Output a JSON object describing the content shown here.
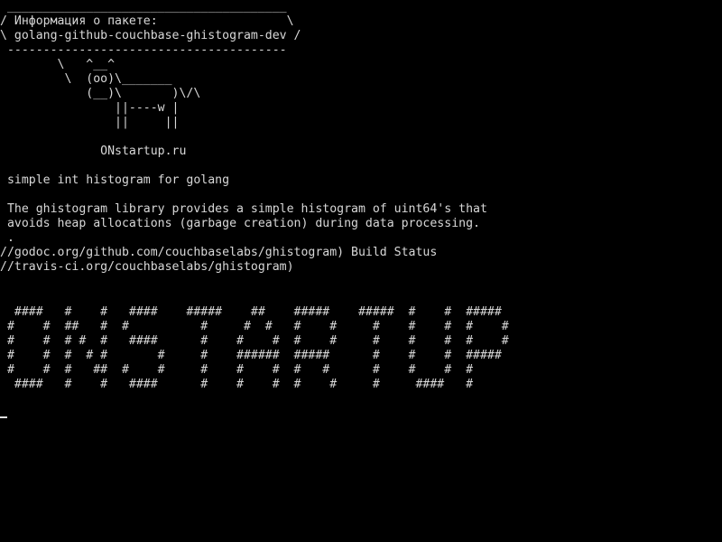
{
  "terminal": {
    "foreground": "#d8d8d8",
    "background": "#000000",
    "lines": [
      " _______________________________________",
      "/ Информация о пакете:                  \\",
      "\\ golang-github-couchbase-ghistogram-dev /",
      " ---------------------------------------",
      "        \\   ^__^",
      "         \\  (oo)\\_______",
      "            (__)\\       )\\/\\",
      "                ||----w |",
      "                ||     ||",
      "",
      "              ONstartup.ru",
      "",
      " simple int histogram for golang",
      "",
      " The ghistogram library provides a simple histogram of uint64's that",
      " avoids heap allocations (garbage creation) during data processing.",
      " .",
      "//godoc.org/github.com/couchbaselabs/ghistogram) Build Status",
      "//travis-ci.org/couchbaselabs/ghistogram)",
      "",
      "",
      "  ####   #    #   ####    #####    ##    #####    #####  #    #  #####",
      " #    #  ##   #  #          #     #  #   #    #     #    #    #  #    #",
      " #    #  # #  #   ####      #    #    #  #    #     #    #    #  #    #",
      " #    #  #  # #       #     #    ######  #####      #    #    #  #####",
      " #    #  #   ##  #    #     #    #    #  #   #      #    #    #  #",
      "  ####   #    #   ####      #    #    #  #    #     #     ####   #"
    ]
  }
}
